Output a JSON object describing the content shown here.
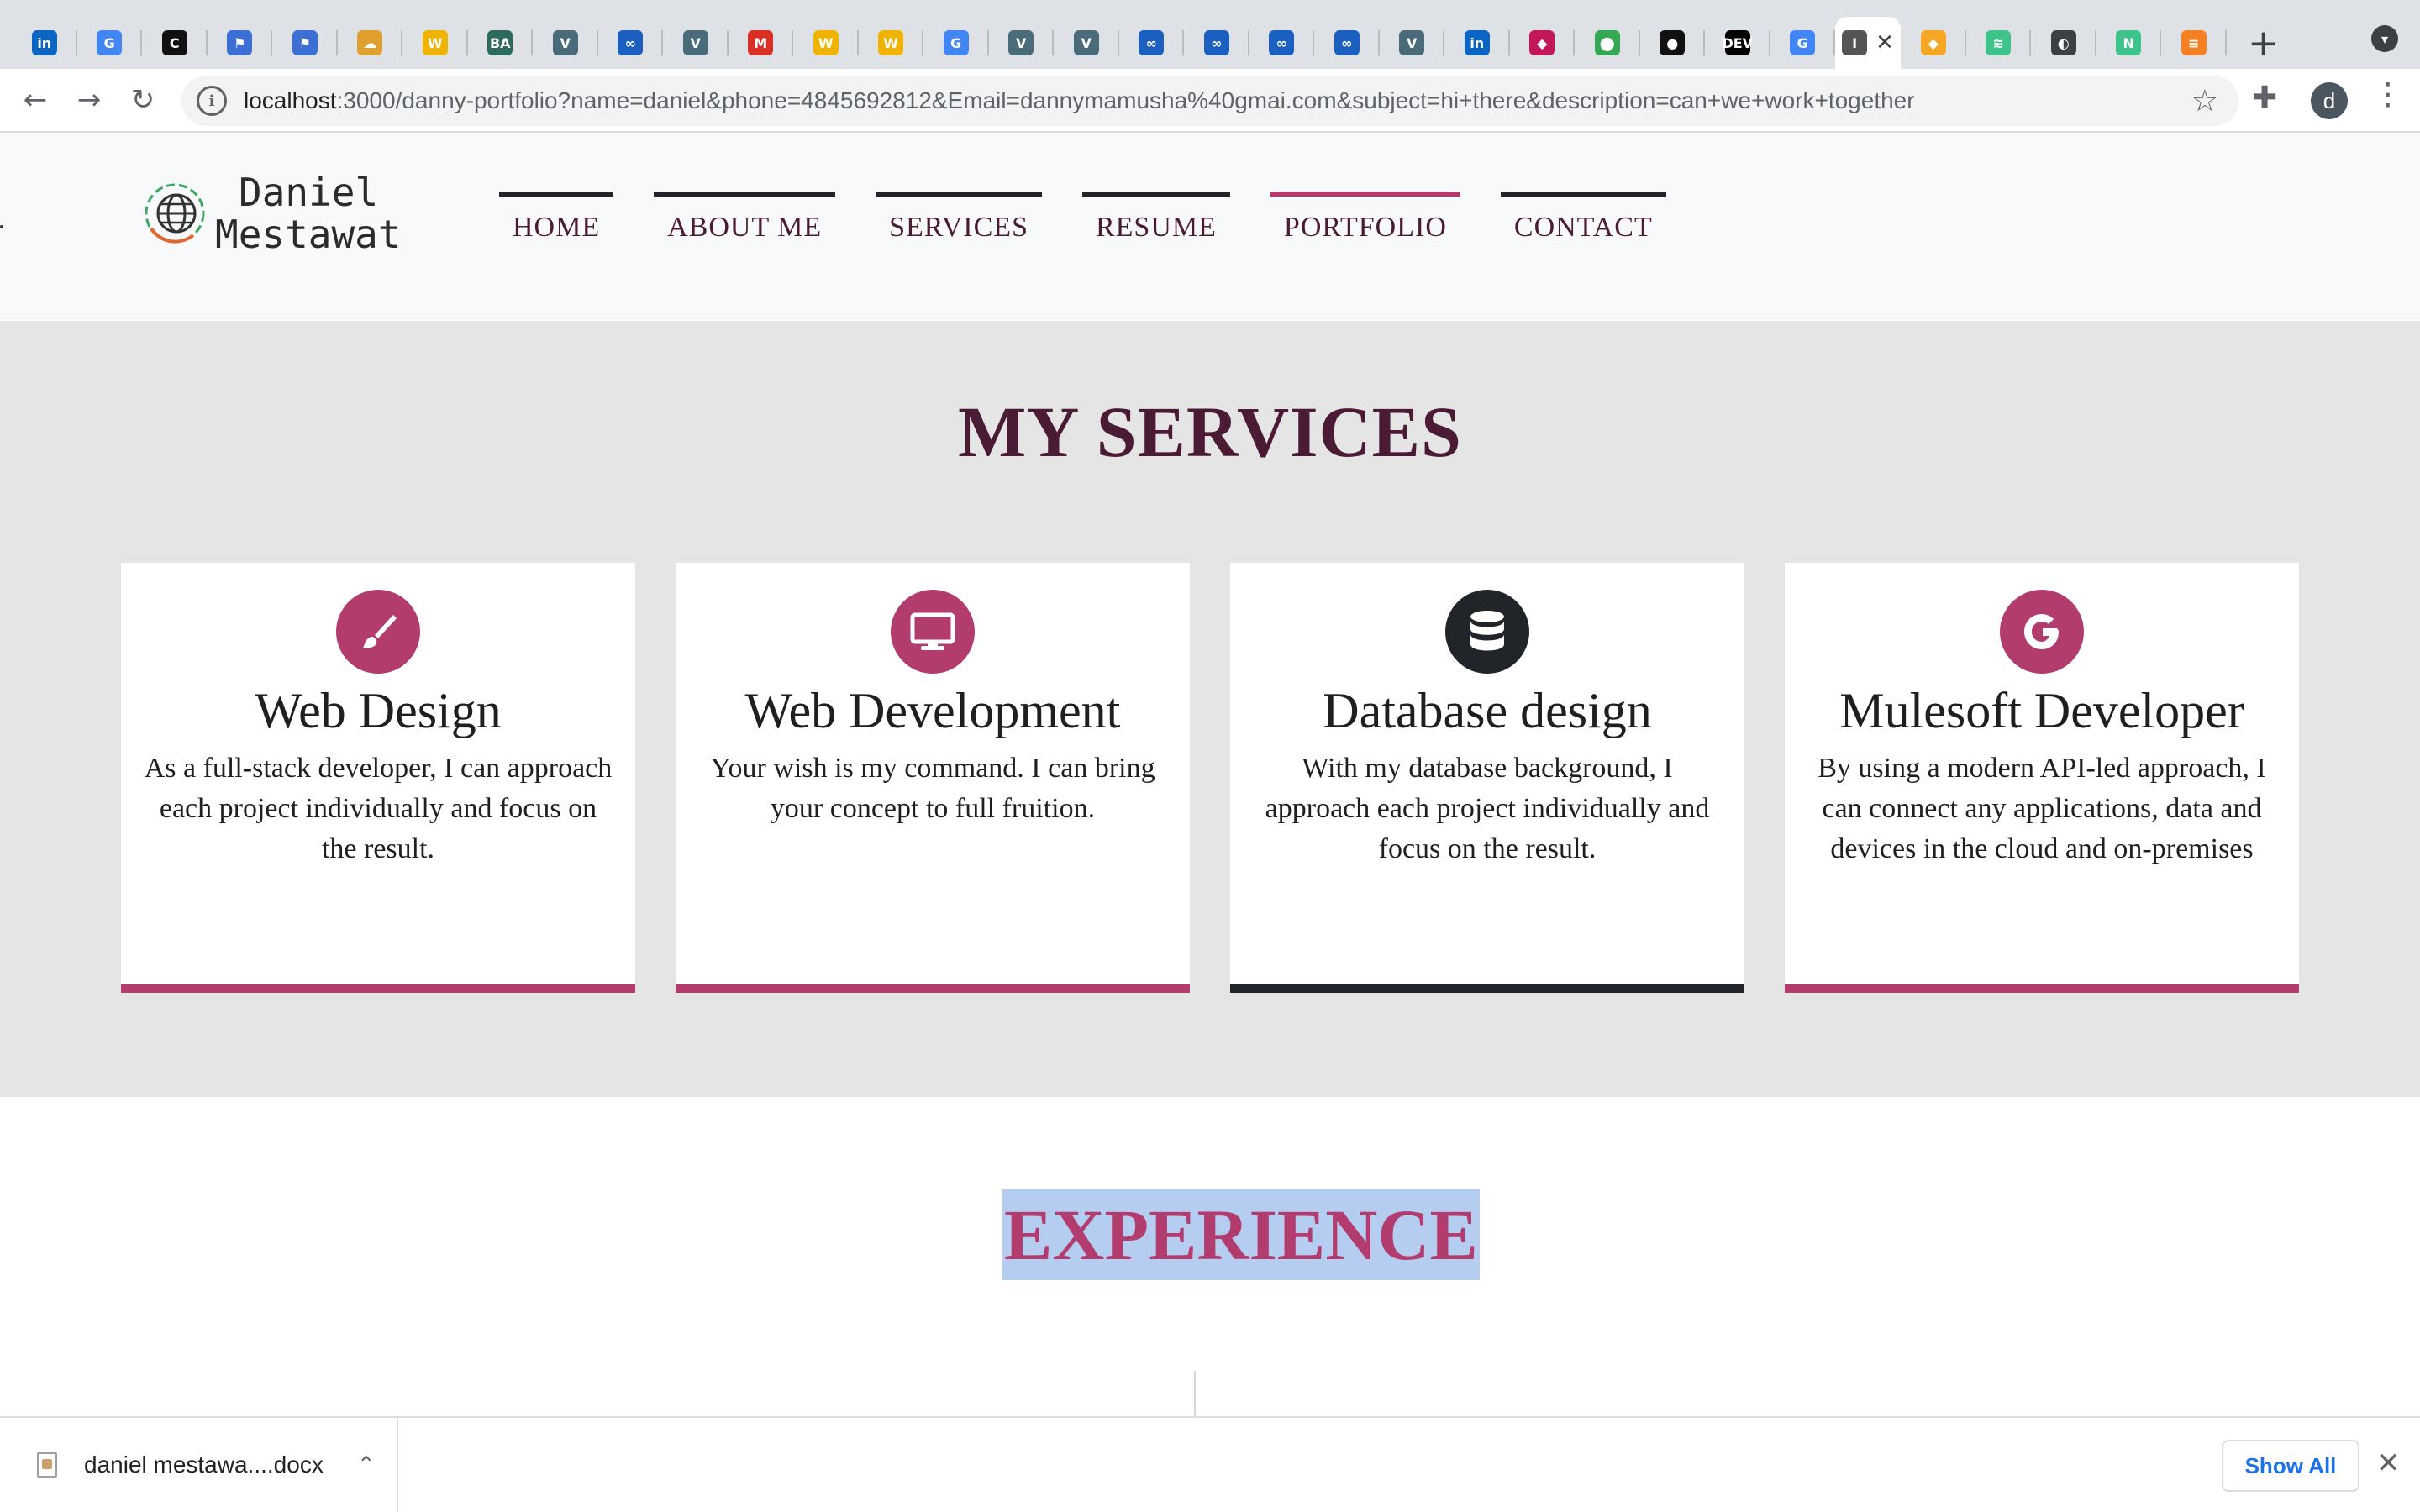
{
  "browser": {
    "tabs": [
      {
        "icon": "linkedin-icon",
        "glyph": "in",
        "color": "#0a66c2"
      },
      {
        "icon": "google-icon",
        "glyph": "G",
        "color": "#4285f4"
      },
      {
        "icon": "c-icon",
        "glyph": "C",
        "color": "#111111"
      },
      {
        "icon": "flag-icon",
        "glyph": "⚑",
        "color": "#3b6fd4"
      },
      {
        "icon": "flag-icon",
        "glyph": "⚑",
        "color": "#3b6fd4"
      },
      {
        "icon": "cloud-icon",
        "glyph": "☁",
        "color": "#e0a030"
      },
      {
        "icon": "w-icon",
        "glyph": "W",
        "color": "#f0b400"
      },
      {
        "icon": "booz-allen-icon",
        "glyph": "BA",
        "color": "#2e6b5f"
      },
      {
        "icon": "vec-icon",
        "glyph": "V",
        "color": "#4a6b7a"
      },
      {
        "icon": "go-icon",
        "glyph": "∞",
        "color": "#1b5fc1"
      },
      {
        "icon": "vec-icon",
        "glyph": "V",
        "color": "#4a6b7a"
      },
      {
        "icon": "gmail-icon",
        "glyph": "M",
        "color": "#d93025"
      },
      {
        "icon": "w-icon",
        "glyph": "W",
        "color": "#f0b400"
      },
      {
        "icon": "w-icon",
        "glyph": "W",
        "color": "#f0b400"
      },
      {
        "icon": "google-icon",
        "glyph": "G",
        "color": "#4285f4"
      },
      {
        "icon": "vec-icon",
        "glyph": "V",
        "color": "#4a6b7a"
      },
      {
        "icon": "vec-icon",
        "glyph": "V",
        "color": "#4a6b7a"
      },
      {
        "icon": "go-icon",
        "glyph": "∞",
        "color": "#1b5fc1"
      },
      {
        "icon": "go-icon",
        "glyph": "∞",
        "color": "#1b5fc1"
      },
      {
        "icon": "go-icon",
        "glyph": "∞",
        "color": "#1b5fc1"
      },
      {
        "icon": "go-icon",
        "glyph": "∞",
        "color": "#1b5fc1"
      },
      {
        "icon": "vec-icon",
        "glyph": "V",
        "color": "#4a6b7a"
      },
      {
        "icon": "linkedin-icon",
        "glyph": "in",
        "color": "#0a66c2"
      },
      {
        "icon": "pink-logo-icon",
        "glyph": "◆",
        "color": "#c2185b"
      },
      {
        "icon": "maps-icon",
        "glyph": "⬤",
        "color": "#34a853"
      },
      {
        "icon": "github-icon",
        "glyph": "●",
        "color": "#111111"
      },
      {
        "icon": "dev-icon",
        "glyph": "DEV",
        "color": "#000000"
      },
      {
        "icon": "google-icon",
        "glyph": "G",
        "color": "#4285f4"
      },
      {
        "icon": "current-tab-icon",
        "glyph": "I",
        "color": "#555555",
        "active": true
      },
      {
        "icon": "orange-shield-icon",
        "glyph": "◆",
        "color": "#f5a623"
      },
      {
        "icon": "green-icon",
        "glyph": "≋",
        "color": "#3ec48b"
      },
      {
        "icon": "globe-icon",
        "glyph": "◐",
        "color": "#3c4043"
      },
      {
        "icon": "nylas-icon",
        "glyph": "N",
        "color": "#3ec48b"
      },
      {
        "icon": "stack-icon",
        "glyph": "≡",
        "color": "#f48024"
      }
    ],
    "url_host": "localhost",
    "url_rest": ":3000/danny-portfolio?name=daniel&phone=4845692812&Email=dannymamusha%40gmai.com&subject=hi+there&description=can+we+work+together",
    "profile_initial": "d"
  },
  "site": {
    "logo_line1": "Daniel",
    "logo_line2": "Mestawat",
    "nav": [
      {
        "label": "HOME",
        "active": false
      },
      {
        "label": "ABOUT ME",
        "active": false
      },
      {
        "label": "SERVICES",
        "active": false
      },
      {
        "label": "RESUME",
        "active": false
      },
      {
        "label": "PORTFOLIO",
        "active": true
      },
      {
        "label": "CONTACT",
        "active": false
      }
    ]
  },
  "services": {
    "title": "MY SERVICES",
    "cards": [
      {
        "icon": "paintbrush-icon",
        "title": "Web Design",
        "text": "As a full-stack developer, I can approach each project individually and focus on the result."
      },
      {
        "icon": "monitor-icon",
        "title": "Web Development",
        "text": "Your wish is my command. I can bring your concept to full fruition."
      },
      {
        "icon": "database-icon",
        "title": "Database design",
        "text": "With my database background, I approach each project individually and focus on the result."
      },
      {
        "icon": "google-g-icon",
        "title": "Mulesoft Developer",
        "text": "By using a modern API-led approach, I can connect any applications, data and devices in the cloud and on-premises"
      }
    ]
  },
  "experience": {
    "title": "EXPERIENCE"
  },
  "downloads": {
    "file_name": "daniel mestawa....docx",
    "show_all": "Show All"
  },
  "colors": {
    "accent": "#b23c6d",
    "dark": "#212529",
    "heading": "#4b1a35",
    "services_bg": "#e5e5e5",
    "selection": "#b4cdf1"
  }
}
